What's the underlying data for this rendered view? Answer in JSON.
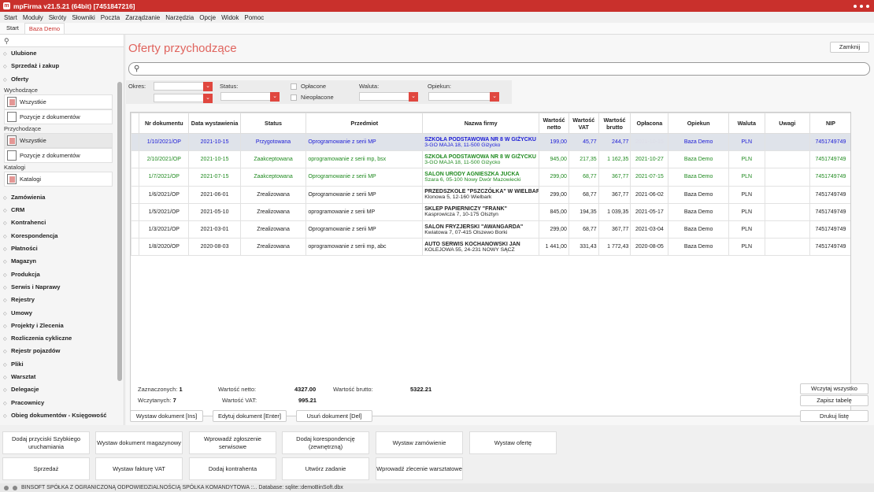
{
  "app": {
    "title": "mpFirma v21.5.21 (64bit) [7451847216]"
  },
  "menu": [
    "Start",
    "Moduły",
    "Skróty",
    "Słowniki",
    "Poczta",
    "Zarządzanie",
    "Narzędzia",
    "Opcje",
    "Widok",
    "Pomoc"
  ],
  "tabs": [
    "Start",
    "Baza Demo"
  ],
  "sidebar": {
    "search_icon": "search-icon",
    "top_cats": [
      "Ulubione",
      "Sprzedaż i zakup",
      "Oferty"
    ],
    "wych_label": "Wychodzące",
    "wych_items": [
      "Wszystkie",
      "Pozycje z dokumentów"
    ],
    "przych_label": "Przychodzące",
    "przych_items": [
      "Wszystkie",
      "Pozycje z dokumentów"
    ],
    "kat_label": "Katalogi",
    "kat_items": [
      "Katalogi"
    ],
    "cats": [
      "Zamówienia",
      "CRM",
      "Kontrahenci",
      "Korespondencja",
      "Płatności",
      "Magazyn",
      "Produkcja",
      "Serwis i Naprawy",
      "Rejestry",
      "Umowy",
      "Projekty i Zlecenia",
      "Rozliczenia cykliczne",
      "Rejestr pojazdów",
      "Pliki",
      "Warsztat",
      "Delegacje",
      "Pracownicy",
      "Obieg dokumentów - Księgowość"
    ]
  },
  "page": {
    "title": "Oferty przychodzące",
    "close_label": "Zamknij",
    "search_value": ""
  },
  "filters": {
    "okres": "Okres:",
    "status": "Status:",
    "oplacone": "Opłacone",
    "nieoplacone": "Nieopłacone",
    "waluta": "Waluta:",
    "opiekun": "Opiekun:"
  },
  "columns": [
    "Nr dokumentu",
    "Data wystawienia",
    "Status",
    "Przedmiot",
    "Nazwa firmy",
    "Wartość netto",
    "Wartość VAT",
    "Wartość brutto",
    "Opłacona",
    "Opiekun",
    "Waluta",
    "Uwagi",
    "NIP"
  ],
  "rows": [
    {
      "nr": "1/10/2021/OP",
      "data": "2021-10-15",
      "status": "Przygotowana",
      "przedmiot": "Oprogramowanie z serii MP",
      "firma": "SZKOŁA PODSTAWOWA NR 8 W GIŻYCKU",
      "adres": "3-GO MAJA 18, 11-500 Giżycko",
      "netto": "199,00",
      "vat": "45,77",
      "brutto": "244,77",
      "oplacona": "2021-10-15",
      "opiekun": "Baza Demo",
      "waluta": "PLN",
      "uwagi": "",
      "nip": "7451749749",
      "color": "blue"
    },
    {
      "nr": "2/10/2021/OP",
      "data": "2021-10-15",
      "status": "Zaakceptowana",
      "przedmiot": "oprogramowanie z serii mp, bsx",
      "firma": "SZKOŁA PODSTAWOWA NR 8 W GIŻYCKU",
      "adres": "3-GO MAJA 18, 11-500 Giżycko",
      "netto": "945,00",
      "vat": "217,35",
      "brutto": "1 162,35",
      "oplacona": "2021-10-27",
      "opiekun": "Baza Demo",
      "waluta": "PLN",
      "uwagi": "",
      "nip": "7451749749",
      "color": "green"
    },
    {
      "nr": "1/7/2021/OP",
      "data": "2021-07-15",
      "status": "Zaakceptowana",
      "przedmiot": "Oprogramowanie z serii MP",
      "firma": "SALON URODY AGNIESZKA JUCKA",
      "adres": "Szara 6, 05-100 Nowy Dwór Mazowiecki",
      "netto": "299,00",
      "vat": "68,77",
      "brutto": "367,77",
      "oplacona": "2021-07-15",
      "opiekun": "Baza Demo",
      "waluta": "PLN",
      "uwagi": "",
      "nip": "7451749749",
      "color": "green"
    },
    {
      "nr": "1/6/2021/OP",
      "data": "2021-06-01",
      "status": "Zrealizowana",
      "przedmiot": "Oprogramowanie z serii MP",
      "firma": "PRZEDSZKOLE \"PSZCZÓŁKA\" W WIELBARKU",
      "adres": "Klonowa 5, 12-160 Wielbark",
      "netto": "299,00",
      "vat": "68,77",
      "brutto": "367,77",
      "oplacona": "2021-06-02",
      "opiekun": "Baza Demo",
      "waluta": "PLN",
      "uwagi": "",
      "nip": "7451749749",
      "color": "black"
    },
    {
      "nr": "1/5/2021/OP",
      "data": "2021-05-10",
      "status": "Zrealizowana",
      "przedmiot": "oprogramowanie z serii MP",
      "firma": "SKLEP PAPIERNICZY \"FRANK\"",
      "adres": "Kasprowicza 7, 10-175 Olsztyn",
      "netto": "845,00",
      "vat": "194,35",
      "brutto": "1 039,35",
      "oplacona": "2021-05-17",
      "opiekun": "Baza Demo",
      "waluta": "PLN",
      "uwagi": "",
      "nip": "7451749749",
      "color": "black"
    },
    {
      "nr": "1/3/2021/OP",
      "data": "2021-03-01",
      "status": "Zrealizowana",
      "przedmiot": "Oprogramowanie z serii MP",
      "firma": "SALON FRYZJERSKI \"AWANGARDA\"",
      "adres": "Kwiatowa 7, 07-415 Olszewo Borki",
      "netto": "299,00",
      "vat": "68,77",
      "brutto": "367,77",
      "oplacona": "2021-03-04",
      "opiekun": "Baza Demo",
      "waluta": "PLN",
      "uwagi": "",
      "nip": "7451749749",
      "color": "black"
    },
    {
      "nr": "1/8/2020/OP",
      "data": "2020-08-03",
      "status": "Zrealizowana",
      "przedmiot": "oprogramowanie z serii mp, abc",
      "firma": "AUTO SERWIS KOCHANOWSKI JAN",
      "adres": "KOLEJOWA 55, 24-231 NOWY SĄCZ",
      "netto": "1 441,00",
      "vat": "331,43",
      "brutto": "1 772,43",
      "oplacona": "2020-08-05",
      "opiekun": "Baza Demo",
      "waluta": "PLN",
      "uwagi": "",
      "nip": "7451749749",
      "color": "black"
    }
  ],
  "summary": {
    "zazn_label": "Zaznaczonych:",
    "zazn": "1",
    "wczyt_label": "Wczytanych:",
    "wczyt": "7",
    "netto_label": "Wartość netto:",
    "netto": "4327.00",
    "vat_label": "Wartość VAT:",
    "vat": "995.21",
    "brutto_label": "Wartość brutto:",
    "brutto": "5322.21"
  },
  "right_buttons": [
    "Wczytaj wszystko",
    "Zapisz tabelę",
    "Drukuj listę"
  ],
  "actions": [
    "Wystaw dokument [Ins]",
    "Edytuj dokument [Enter]",
    "Usuń dokument [Del]"
  ],
  "quick": [
    "Dodaj przyciski Szybkiego uruchamiania",
    "Wystaw dokument magazynowy",
    "Wprowadź zgłoszenie serwisowe",
    "Dodaj korespondencję (zewnętrzną)",
    "Wystaw zamówienie",
    "Wystaw ofertę",
    "Sprzedaż",
    "Wystaw fakturę VAT",
    "Dodaj kontrahenta",
    "Utwórz zadanie",
    "Wprowadź zlecenie warsztatowe"
  ],
  "status_text": "BINSOFT SPÓŁKA Z OGRANICZONĄ ODPOWIEDZIALNOŚCIĄ SPÓŁKA KOMANDYTOWA ::.. Database: sqlite::demoBinSoft.dbx",
  "colors": {
    "accent": "#c9302c",
    "title": "#e0645e",
    "blue_row": "#1a1ad6",
    "green_row": "#1f8a1f"
  }
}
